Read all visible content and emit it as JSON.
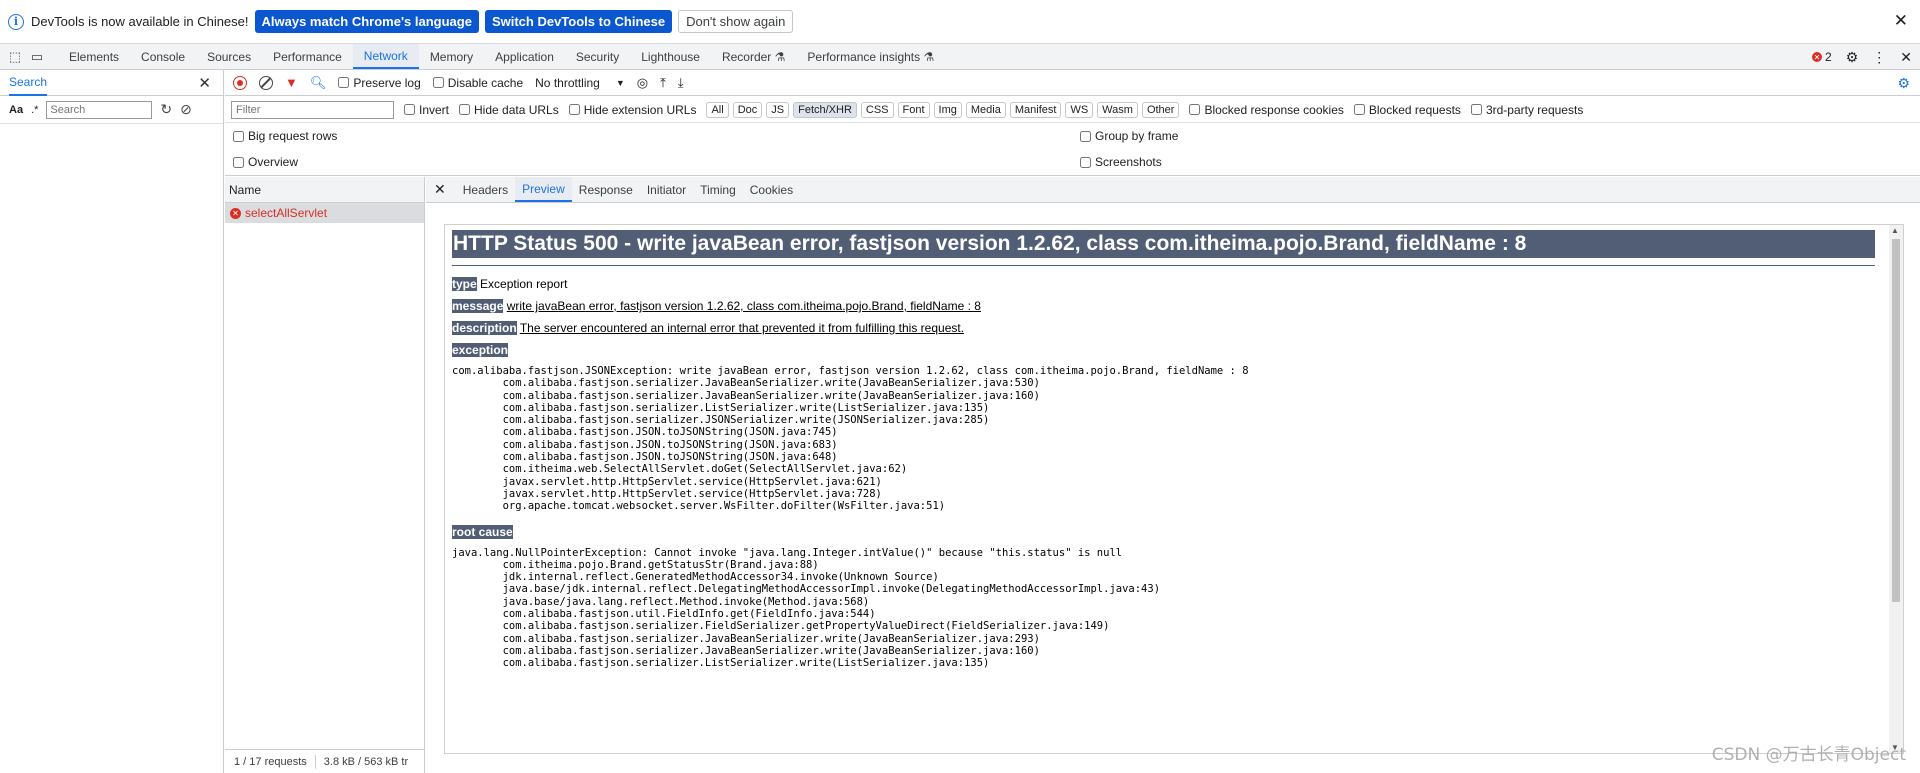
{
  "infobar": {
    "message": "DevTools is now available in Chinese!",
    "btn_match": "Always match Chrome's language",
    "btn_switch": "Switch DevTools to Chinese",
    "btn_dismiss": "Don't show again"
  },
  "tabs": [
    "Elements",
    "Console",
    "Sources",
    "Performance",
    "Network",
    "Memory",
    "Application",
    "Security",
    "Lighthouse",
    "Recorder ⚗",
    "Performance insights ⚗"
  ],
  "active_tab": "Network",
  "error_count": "2",
  "search_panel": {
    "title": "Search",
    "case_label": "Aa",
    "regex_label": ".*",
    "placeholder": "Search"
  },
  "network": {
    "preserve_log": "Preserve log",
    "disable_cache": "Disable cache",
    "throttling": "No throttling",
    "filter_placeholder": "Filter",
    "invert": "Invert",
    "hide_data_urls": "Hide data URLs",
    "hide_extension_urls": "Hide extension URLs",
    "type_filters": [
      "All",
      "Doc",
      "JS",
      "Fetch/XHR",
      "CSS",
      "Font",
      "Img",
      "Media",
      "Manifest",
      "WS",
      "Wasm",
      "Other"
    ],
    "active_filter": "Fetch/XHR",
    "blocked_response_cookies": "Blocked response cookies",
    "blocked_requests": "Blocked requests",
    "third_party": "3rd-party requests",
    "big_request_rows": "Big request rows",
    "overview": "Overview",
    "group_by_frame": "Group by frame",
    "screenshots": "Screenshots"
  },
  "request_list": {
    "header": "Name",
    "rows": [
      {
        "name": "selectAllServlet",
        "status": "error"
      }
    ],
    "requests_summary": "1 / 17 requests",
    "transfer_summary": "3.8 kB / 563 kB tr"
  },
  "detail_tabs": [
    "Headers",
    "Preview",
    "Response",
    "Initiator",
    "Timing",
    "Cookies"
  ],
  "active_detail_tab": "Preview",
  "error_page": {
    "title": "HTTP Status 500 - write javaBean error, fastjson version 1.2.62, class com.itheima.pojo.Brand, fieldName : 8",
    "type_label": "type",
    "type_value": "Exception report",
    "message_label": "message",
    "message_value": "write javaBean error, fastjson version 1.2.62, class com.itheima.pojo.Brand, fieldName : 8",
    "description_label": "description",
    "description_value": "The server encountered an internal error that prevented it from fulfilling this request.",
    "exception_label": "exception",
    "exception_trace": "com.alibaba.fastjson.JSONException: write javaBean error, fastjson version 1.2.62, class com.itheima.pojo.Brand, fieldName : 8\n\tcom.alibaba.fastjson.serializer.JavaBeanSerializer.write(JavaBeanSerializer.java:530)\n\tcom.alibaba.fastjson.serializer.JavaBeanSerializer.write(JavaBeanSerializer.java:160)\n\tcom.alibaba.fastjson.serializer.ListSerializer.write(ListSerializer.java:135)\n\tcom.alibaba.fastjson.serializer.JSONSerializer.write(JSONSerializer.java:285)\n\tcom.alibaba.fastjson.JSON.toJSONString(JSON.java:745)\n\tcom.alibaba.fastjson.JSON.toJSONString(JSON.java:683)\n\tcom.alibaba.fastjson.JSON.toJSONString(JSON.java:648)\n\tcom.itheima.web.SelectAllServlet.doGet(SelectAllServlet.java:62)\n\tjavax.servlet.http.HttpServlet.service(HttpServlet.java:621)\n\tjavax.servlet.http.HttpServlet.service(HttpServlet.java:728)\n\torg.apache.tomcat.websocket.server.WsFilter.doFilter(WsFilter.java:51)",
    "root_cause_label": "root cause",
    "root_cause_trace": "java.lang.NullPointerException: Cannot invoke \"java.lang.Integer.intValue()\" because \"this.status\" is null\n\tcom.itheima.pojo.Brand.getStatusStr(Brand.java:88)\n\tjdk.internal.reflect.GeneratedMethodAccessor34.invoke(Unknown Source)\n\tjava.base/jdk.internal.reflect.DelegatingMethodAccessorImpl.invoke(DelegatingMethodAccessorImpl.java:43)\n\tjava.base/java.lang.reflect.Method.invoke(Method.java:568)\n\tcom.alibaba.fastjson.util.FieldInfo.get(FieldInfo.java:544)\n\tcom.alibaba.fastjson.serializer.FieldSerializer.getPropertyValueDirect(FieldSerializer.java:149)\n\tcom.alibaba.fastjson.serializer.JavaBeanSerializer.write(JavaBeanSerializer.java:293)\n\tcom.alibaba.fastjson.serializer.JavaBeanSerializer.write(JavaBeanSerializer.java:160)\n\tcom.alibaba.fastjson.serializer.ListSerializer.write(ListSerializer.java:135)"
  },
  "watermark": "CSDN @万古长青Object",
  "colors": {
    "accent": "#1a73e8",
    "error": "#d93025",
    "tomcat_header": "#525d76"
  }
}
